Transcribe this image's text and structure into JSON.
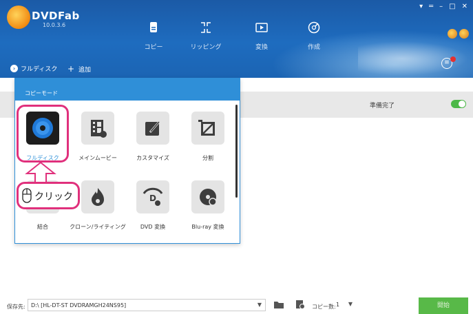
{
  "app": {
    "name": "DVDFab",
    "version": "10.0.3.6"
  },
  "window_controls": [
    "▾",
    "═",
    "–",
    "□",
    "✕"
  ],
  "nav": [
    {
      "label": "コピー",
      "icon": "copy-icon"
    },
    {
      "label": "リッピング",
      "icon": "ripper-icon"
    },
    {
      "label": "変換",
      "icon": "convert-icon"
    },
    {
      "label": "作成",
      "icon": "creator-icon"
    }
  ],
  "toolbar": {
    "mode_label": "フルディスク",
    "add_label": "追加"
  },
  "status": {
    "text": "準備完了",
    "toggle_on": true
  },
  "popup": {
    "title": "コピーモード",
    "modes": [
      {
        "label": "フルディスク",
        "icon": "full-disc-icon",
        "selected": true
      },
      {
        "label": "メインムービー",
        "icon": "main-movie-icon"
      },
      {
        "label": "カスタマイズ",
        "icon": "customize-icon"
      },
      {
        "label": "分割",
        "icon": "split-icon"
      },
      {
        "label": "結合",
        "icon": "merge-icon"
      },
      {
        "label": "クローン/ライティング",
        "icon": "clone-burn-icon"
      },
      {
        "label": "DVD 変換",
        "icon": "dvd-convert-icon"
      },
      {
        "label": "Blu-ray 変換",
        "icon": "bluray-convert-icon"
      }
    ]
  },
  "annotation": {
    "click_text": "クリック"
  },
  "bottom": {
    "save_label": "保存先:",
    "save_value": "D:\\ [HL-DT-ST DVDRAMGH24NS95]",
    "copies_label": "コピー数:",
    "copies_value": "1",
    "start_label": "開始"
  },
  "colors": {
    "header": "#1e6cbf",
    "accent": "#2f8fd8",
    "highlight": "#e0307c",
    "start": "#58b948"
  }
}
